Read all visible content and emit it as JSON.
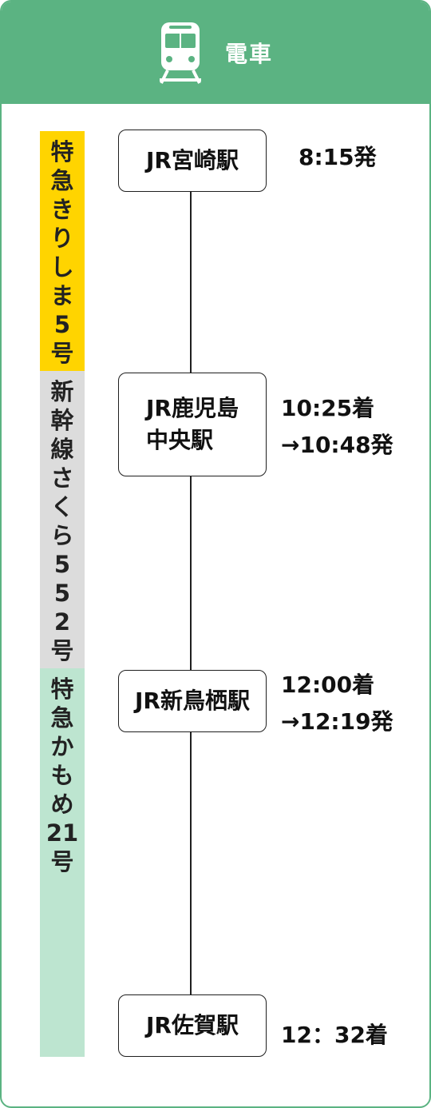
{
  "header": {
    "title": "電車",
    "icon": "train-icon"
  },
  "segments": [
    {
      "label": "特\n急\nき\nり\nし\nま\n5\n号",
      "color": "#ffd400"
    },
    {
      "label": "新\n幹\n線\nさ\nく\nら\n5\n5\n2\n号",
      "color": "#dcdcdc"
    },
    {
      "label": "特\n急\nか\nも\nめ\n21\n号",
      "color": "#bde5d0"
    }
  ],
  "stations": [
    {
      "name": "JR宮崎駅",
      "time": "8:15発"
    },
    {
      "name": "JR鹿児島\n中央駅",
      "time": "10:25着\n→10:48発"
    },
    {
      "name": "JR新鳥栖駅",
      "time": "12:00着\n→12:19発"
    },
    {
      "name": "JR佐賀駅",
      "time": "12：32着"
    }
  ],
  "colors": {
    "accent": "#5bb382"
  }
}
